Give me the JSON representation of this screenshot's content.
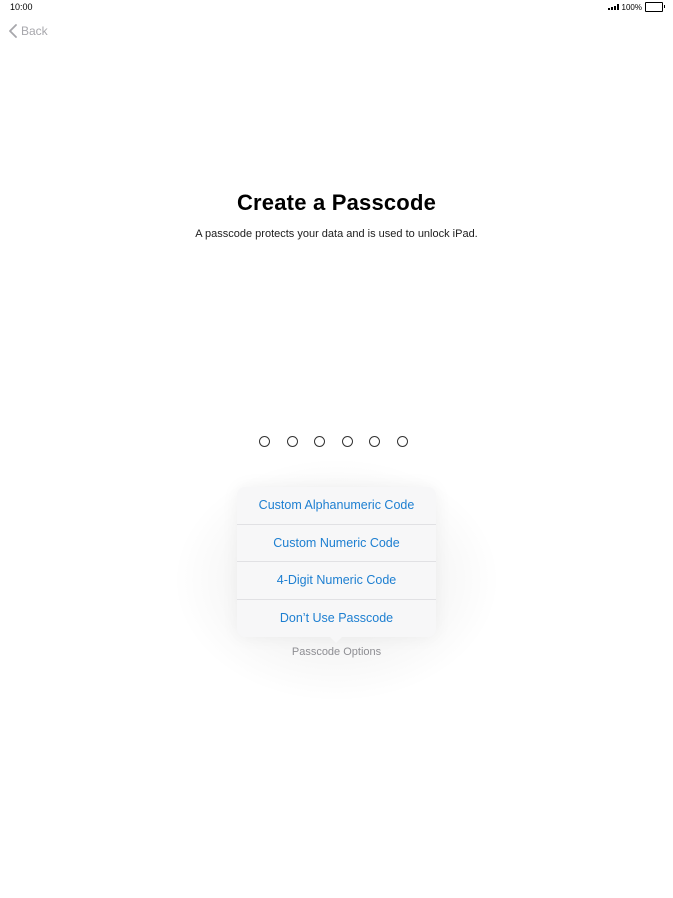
{
  "status_bar": {
    "time": "10:00",
    "battery_percent": "100%"
  },
  "nav": {
    "back_label": "Back"
  },
  "main": {
    "title": "Create a Passcode",
    "subtitle": "A passcode protects your data and is used to unlock iPad.",
    "passcode_length": 6,
    "passcode_filled": 0
  },
  "options_menu": {
    "items": [
      {
        "label": "Custom Alphanumeric Code"
      },
      {
        "label": "Custom Numeric Code"
      },
      {
        "label": "4-Digit Numeric Code"
      },
      {
        "label": "Don’t Use Passcode"
      }
    ],
    "toggle_label": "Passcode Options"
  },
  "colors": {
    "accent": "#1d7fd1",
    "muted": "#8e8e93",
    "back": "#a7a7ac"
  },
  "icons": {
    "back": "chevron-left-icon",
    "signal": "signal-icon",
    "battery": "battery-icon"
  }
}
